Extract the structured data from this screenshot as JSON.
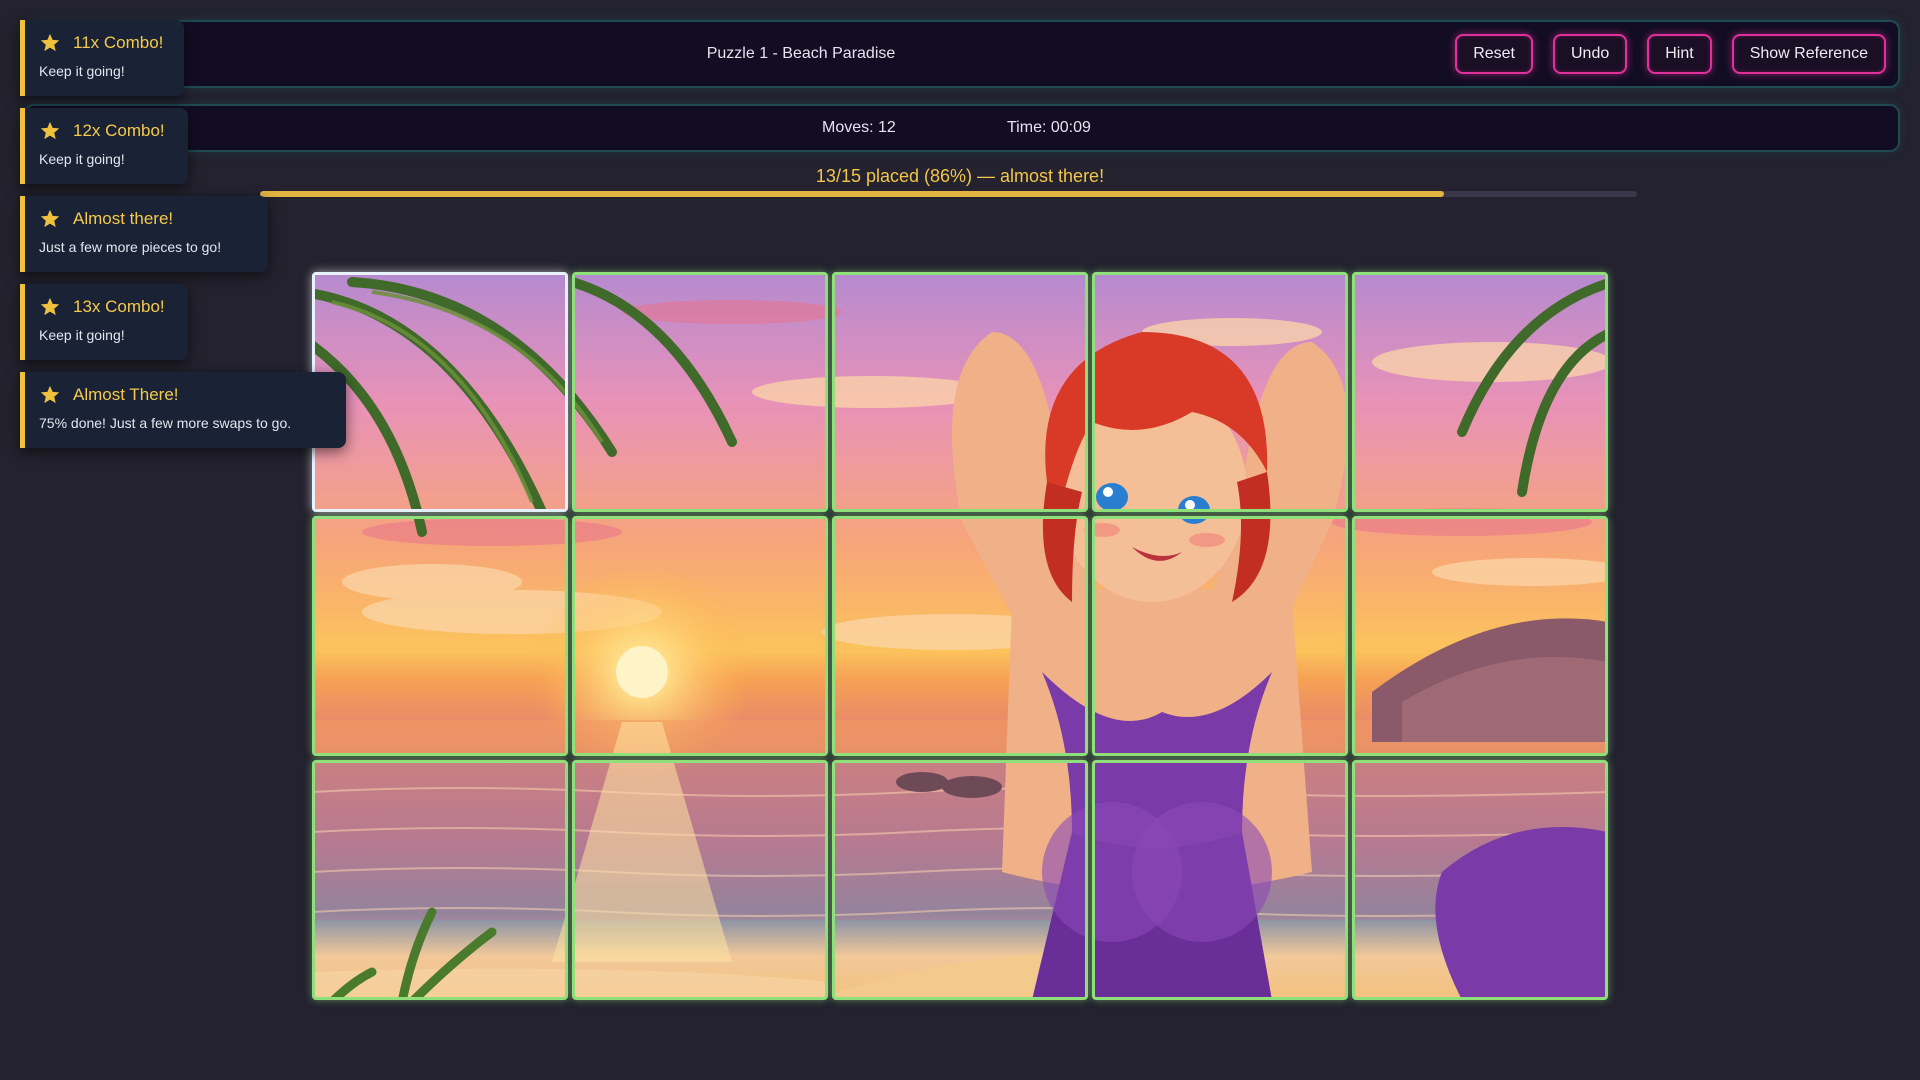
{
  "header": {
    "title": "Puzzle 1 - Beach Paradise",
    "buttons": {
      "reset": "Reset",
      "undo": "Undo",
      "hint": "Hint",
      "show_reference": "Show Reference"
    }
  },
  "stats": {
    "moves": "Moves: 12",
    "time": "Time: 00:09"
  },
  "progress": {
    "text": "13/15 placed (86%) — almost there!",
    "fraction": 0.86
  },
  "toasts": [
    {
      "title": "11x Combo!",
      "message": "Keep it going!",
      "icon": "star-icon"
    },
    {
      "title": "12x Combo!",
      "message": "Keep it going!",
      "icon": "star-icon"
    },
    {
      "title": "Almost there!",
      "message": "Just a few more pieces to go!",
      "icon": "star-icon"
    },
    {
      "title": "13x Combo!",
      "message": "Keep it going!",
      "icon": "star-icon"
    },
    {
      "title": "Almost There!",
      "message": "75% done! Just a few more swaps to go.",
      "icon": "star-icon"
    }
  ],
  "board": {
    "rows": 3,
    "cols": 5,
    "image": "anime girl on sunset beach",
    "selected_tile": 0
  },
  "colors": {
    "accent_pink": "#e0309a",
    "toast_gold": "#f0c23c",
    "placed_green": "#8fe07a",
    "panel_bg": "#130d24"
  }
}
